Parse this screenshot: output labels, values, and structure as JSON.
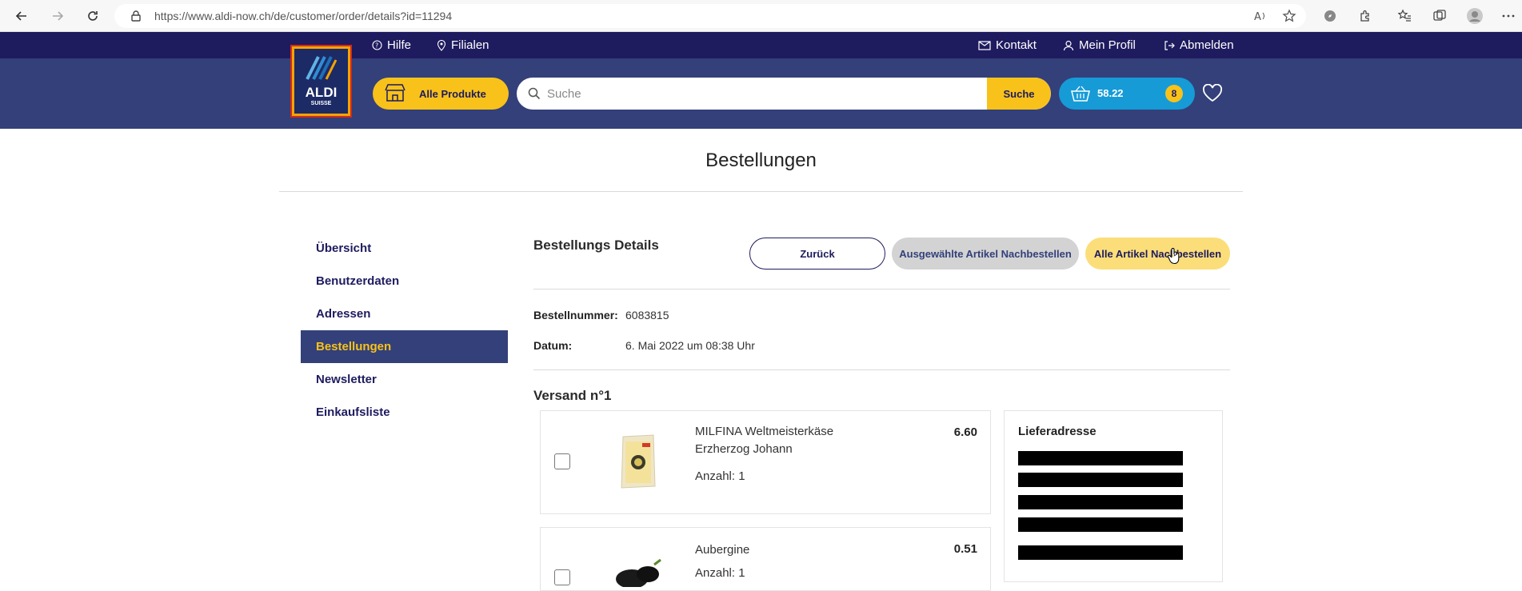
{
  "browser": {
    "url": "https://www.aldi-now.ch/de/customer/order/details?id=11294"
  },
  "topbar": {
    "help": "Hilfe",
    "stores": "Filialen",
    "contact": "Kontakt",
    "profile": "Mein Profil",
    "logout": "Abmelden"
  },
  "logo": {
    "line1": "ALDI",
    "line2": "SUISSE"
  },
  "header": {
    "all_products": "Alle Produkte",
    "search_placeholder": "Suche",
    "search_button": "Suche",
    "cart_total": "58.22",
    "cart_count": "8"
  },
  "page": {
    "title": "Bestellungen"
  },
  "sidebar": {
    "items": [
      {
        "label": "Übersicht"
      },
      {
        "label": "Benutzerdaten"
      },
      {
        "label": "Adressen"
      },
      {
        "label": "Bestellungen"
      },
      {
        "label": "Newsletter"
      },
      {
        "label": "Einkaufsliste"
      }
    ]
  },
  "details": {
    "title": "Bestellungs Details",
    "back_button": "Zurück",
    "reorder_selected_button": "Ausgewählte Artikel Nachbestellen",
    "reorder_all_button": "Alle Artikel Nachbestellen",
    "order_number_label": "Bestellnummer:",
    "order_number": "6083815",
    "date_label": "Datum:",
    "date": "6. Mai 2022 um 08:38 Uhr"
  },
  "shipment": {
    "title": "Versand n°1",
    "address_title": "Lieferadresse",
    "items": [
      {
        "name": "MILFINA Weltmeisterkäse Erzherzog Johann",
        "qty": "Anzahl: 1",
        "price": "6.60"
      },
      {
        "name": "Aubergine",
        "qty": "Anzahl: 1",
        "price": "0.51"
      }
    ]
  },
  "colors": {
    "navy": "#1e1b5f",
    "header_blue": "#33407a",
    "yellow": "#f8c21a",
    "cart_blue": "#169bd7"
  }
}
